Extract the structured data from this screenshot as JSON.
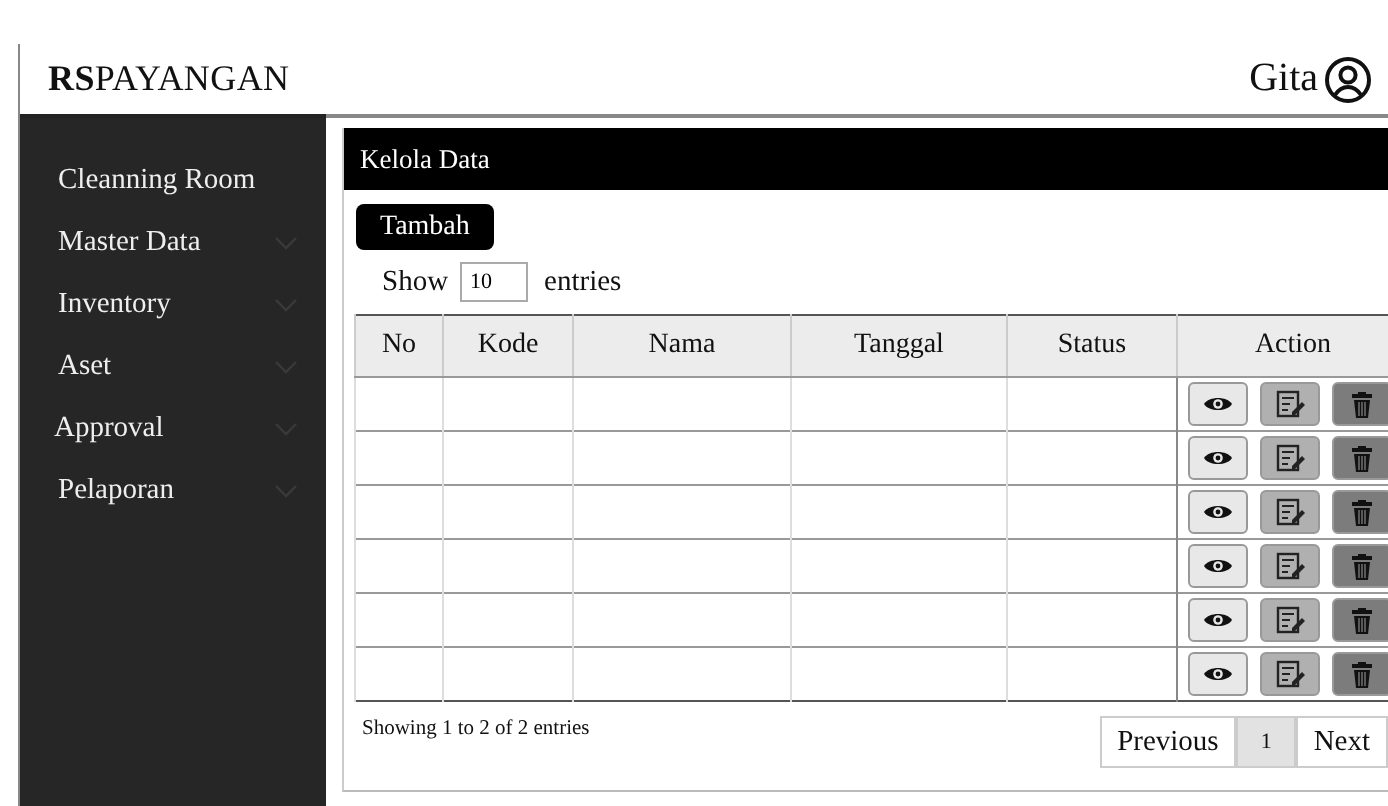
{
  "header": {
    "brand_bold": "RS",
    "brand": "PAYANGAN",
    "user": "Gita"
  },
  "sidebar": {
    "items": [
      {
        "label": "Cleanning Room",
        "has_submenu": false
      },
      {
        "label": "Master Data",
        "has_submenu": true
      },
      {
        "label": "Inventory",
        "has_submenu": true
      },
      {
        "label": "Aset",
        "has_submenu": true
      },
      {
        "label": "Approval",
        "has_submenu": true
      },
      {
        "label": "Pelaporan",
        "has_submenu": true
      }
    ]
  },
  "panel": {
    "title": "Kelola Data",
    "add_button": "Tambah",
    "show_label": "Show",
    "page_size": "10",
    "entries_label": "entries"
  },
  "table": {
    "columns": [
      "No",
      "Kode",
      "Nama",
      "Tanggal",
      "Status",
      "Action"
    ],
    "rows": [
      {
        "actions": [
          {
            "kind": "view"
          },
          {
            "kind": "edit"
          },
          {
            "kind": "delete"
          }
        ]
      },
      {
        "actions": [
          {
            "kind": "view"
          },
          {
            "kind": "edit"
          },
          {
            "kind": "delete"
          }
        ]
      },
      {
        "actions": [
          {
            "kind": "view"
          },
          {
            "kind": "edit"
          },
          {
            "kind": "delete"
          }
        ]
      },
      {
        "actions": [
          {
            "kind": "view"
          },
          {
            "kind": "edit"
          },
          {
            "kind": "delete"
          }
        ]
      },
      {
        "actions": [
          {
            "kind": "view"
          },
          {
            "kind": "edit"
          },
          {
            "kind": "delete"
          }
        ]
      },
      {
        "actions": [
          {
            "kind": "view"
          },
          {
            "kind": "edit"
          },
          {
            "kind": "delete"
          }
        ]
      }
    ]
  },
  "footer": {
    "info": "Showing 1 to 2 of 2 entries",
    "pagination": [
      {
        "label": "Previous",
        "selected": false
      },
      {
        "label": "1",
        "selected": true
      },
      {
        "label": "Next",
        "selected": false
      }
    ]
  }
}
